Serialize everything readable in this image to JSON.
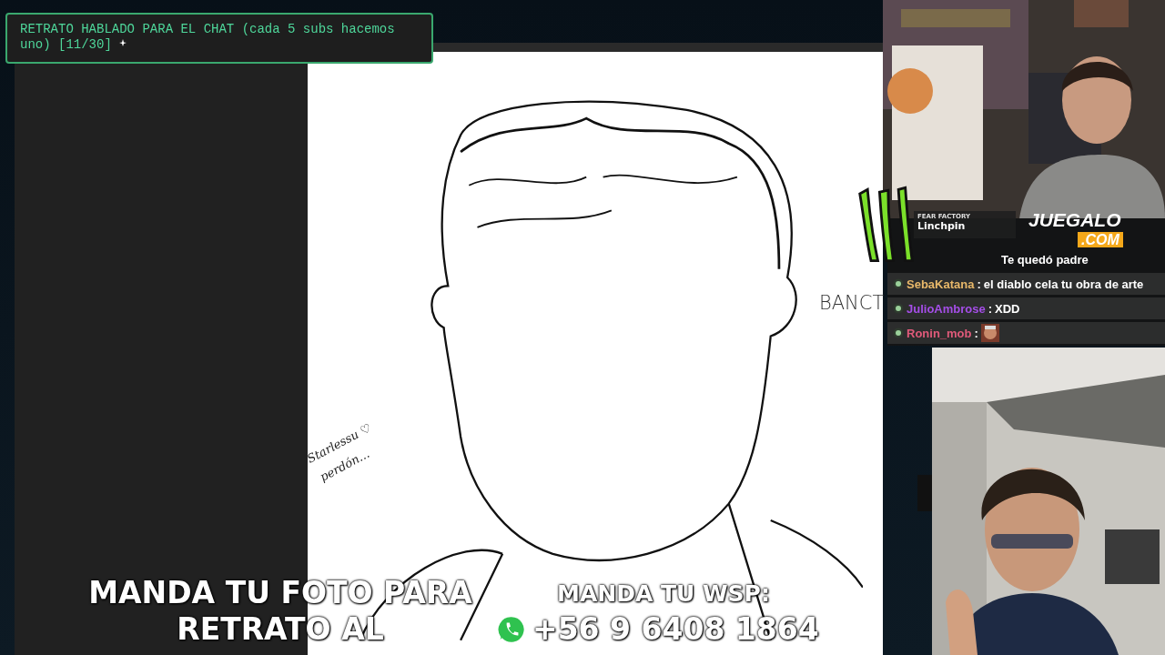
{
  "title_box": {
    "text": "RETRATO HABLADO PARA EL CHAT (cada 5 subs hacemos uno) [11/30]"
  },
  "canvas": {
    "notes": [
      {
        "kind": "signature",
        "text": "Starlessu ♡"
      },
      {
        "kind": "signature",
        "text": "perdón..."
      },
      {
        "kind": "caption",
        "text": "BANCT"
      }
    ]
  },
  "now_playing": {
    "artist": "FEAR FACTORY",
    "song": "Linchpin"
  },
  "sponsor": {
    "name": "JUEGALO",
    "suffix": ".COM"
  },
  "chat": [
    {
      "message": "Te quedó padre",
      "kind": "text"
    },
    {
      "user": "SebaKatana",
      "color": "#e8b86a",
      "separator": ":",
      "message": "el diablo cela tu obra de arte",
      "kind": "text"
    },
    {
      "user": "JulioAmbrose",
      "color": "#a54ee8",
      "separator": ":",
      "message": "XDD",
      "kind": "text"
    },
    {
      "user": "Ronin_mob",
      "color": "#e05a7a",
      "separator": ":",
      "kind": "emote"
    }
  ],
  "banner": {
    "left": [
      "MANDA TU FOTO PARA",
      "RETRATO AL"
    ],
    "right_title": "MANDA TU WSP:",
    "phone": "+56 9 6408 1864"
  }
}
